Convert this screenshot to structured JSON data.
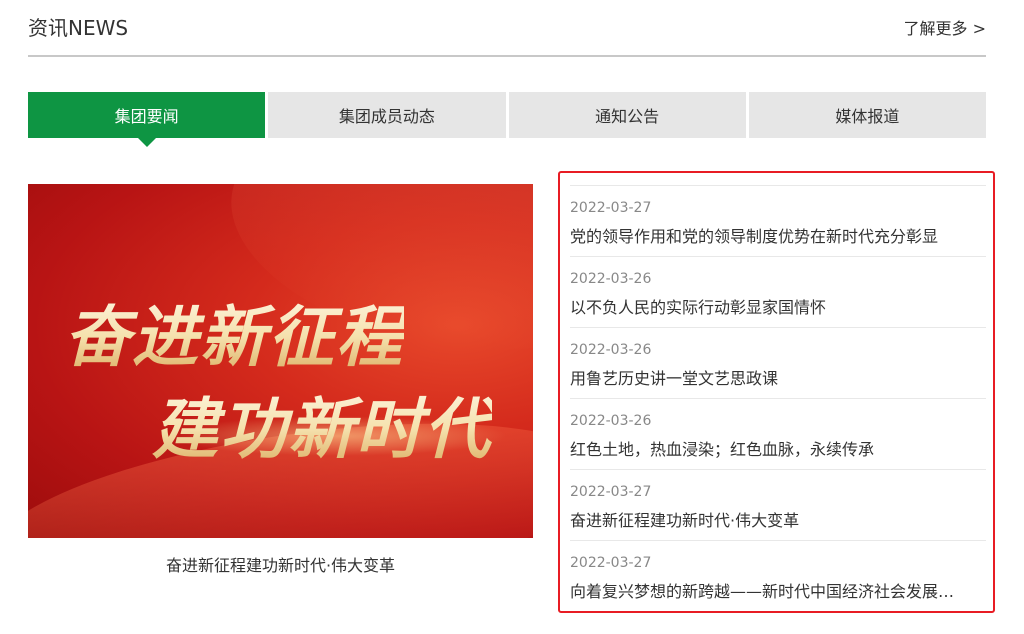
{
  "header": {
    "title": "资讯NEWS",
    "more_link": "了解更多 >"
  },
  "tabs": [
    {
      "label": "集团要闻",
      "active": true
    },
    {
      "label": "集团成员动态",
      "active": false
    },
    {
      "label": "通知公告",
      "active": false
    },
    {
      "label": "媒体报道",
      "active": false
    }
  ],
  "feature": {
    "banner_line1": "奋进新征程",
    "banner_line2": "建功新时代",
    "caption": "奋进新征程建功新时代·伟大变革"
  },
  "news": [
    {
      "date": "2022-03-27",
      "title": "党的领导作用和党的领导制度优势在新时代充分彰显"
    },
    {
      "date": "2022-03-26",
      "title": "以不负人民的实际行动彰显家国情怀"
    },
    {
      "date": "2022-03-26",
      "title": "用鲁艺历史讲一堂文艺思政课"
    },
    {
      "date": "2022-03-26",
      "title": "红色土地，热血浸染；红色血脉，永续传承"
    },
    {
      "date": "2022-03-27",
      "title": "奋进新征程建功新时代·伟大变革"
    },
    {
      "date": "2022-03-27",
      "title": "向着复兴梦想的新跨越——新时代中国经济社会发展…"
    }
  ],
  "colors": {
    "accent_green": "#0e9543",
    "highlight_red": "#e81c24",
    "tab_inactive": "#e6e6e6"
  }
}
